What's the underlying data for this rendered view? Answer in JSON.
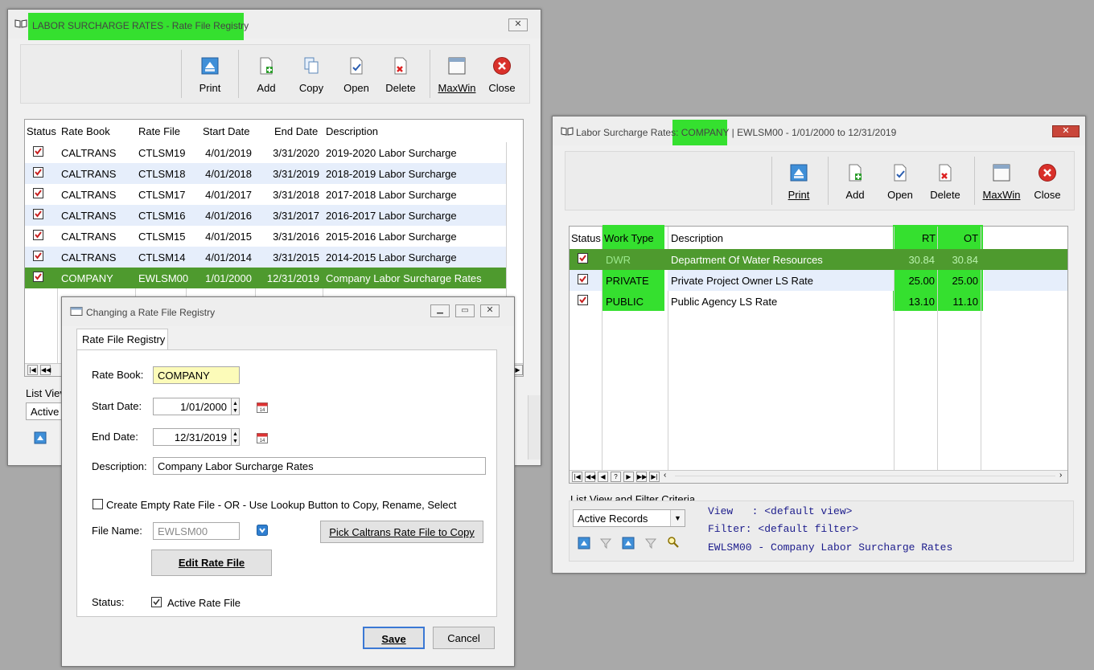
{
  "win1": {
    "title": "LABOR SURCHARGE RATES - Rate File Registry",
    "toolbar": {
      "print": "Print",
      "add": "Add",
      "copy": "Copy",
      "open": "Open",
      "delete": "Delete",
      "maxwin": "MaxWin",
      "close": "Close"
    },
    "columns": [
      "Status",
      "Rate Book",
      "Rate File",
      "Start Date",
      "End Date",
      "Description"
    ],
    "rows": [
      {
        "book": "CALTRANS",
        "file": "CTLSM19",
        "start": "4/01/2019",
        "end": "3/31/2020",
        "desc": "2019-2020 Labor Surcharge"
      },
      {
        "book": "CALTRANS",
        "file": "CTLSM18",
        "start": "4/01/2018",
        "end": "3/31/2019",
        "desc": "2018-2019 Labor Surcharge"
      },
      {
        "book": "CALTRANS",
        "file": "CTLSM17",
        "start": "4/01/2017",
        "end": "3/31/2018",
        "desc": "2017-2018 Labor Surcharge"
      },
      {
        "book": "CALTRANS",
        "file": "CTLSM16",
        "start": "4/01/2016",
        "end": "3/31/2017",
        "desc": "2016-2017 Labor Surcharge"
      },
      {
        "book": "CALTRANS",
        "file": "CTLSM15",
        "start": "4/01/2015",
        "end": "3/31/2016",
        "desc": "2015-2016 Labor Surcharge"
      },
      {
        "book": "CALTRANS",
        "file": "CTLSM14",
        "start": "4/01/2014",
        "end": "3/31/2015",
        "desc": "2014-2015 Labor Surcharge"
      },
      {
        "book": "COMPANY",
        "file": "EWLSM00",
        "start": "1/01/2000",
        "end": "12/31/2019",
        "desc": "Company Labor Surcharge Rates"
      }
    ],
    "list_view_label": "List Viev",
    "list_view_value": "Active"
  },
  "win2": {
    "title_prefix": "Labor Surcharge Rates: ",
    "title_company": "COMPANY",
    "title_suffix": " | EWLSM00 -  1/01/2000 to 12/31/2019",
    "toolbar": {
      "print": "Print",
      "add": "Add",
      "open": "Open",
      "delete": "Delete",
      "maxwin": "MaxWin",
      "close": "Close"
    },
    "columns": [
      "Status",
      "Work Type",
      "Description",
      "RT",
      "OT"
    ],
    "rows": [
      {
        "type": "DWR",
        "desc": "Department Of Water Resources",
        "rt": "30.84",
        "ot": "30.84"
      },
      {
        "type": "PRIVATE",
        "desc": "Private Project Owner LS Rate",
        "rt": "25.00",
        "ot": "25.00"
      },
      {
        "type": "PUBLIC",
        "desc": "Public Agency LS Rate",
        "rt": "13.10",
        "ot": "11.10"
      }
    ],
    "filter_label": "List View and Filter Criteria",
    "filter_select": "Active Records",
    "view_line": "View   : <default view>",
    "filter_line": "Filter: <default filter>",
    "file_line": "EWLSM00 - Company Labor Surcharge Rates"
  },
  "dialog": {
    "title": "Changing a Rate File Registry",
    "tab": "Rate File Registry",
    "rate_book_label": "Rate Book:",
    "rate_book_value": "COMPANY",
    "start_label": "Start Date:",
    "start_value": "1/01/2000",
    "end_label": "End Date:",
    "end_value": "12/31/2019",
    "desc_label": "Description:",
    "desc_value": "Company Labor Surcharge Rates",
    "create_empty_label": "Create Empty Rate File - OR - Use Lookup Button to Copy, Rename, Select",
    "file_name_label": "File Name:",
    "file_name_value": "EWLSM00",
    "pick_button": "Pick Caltrans Rate File to Copy",
    "edit_button": "Edit Rate File",
    "status_label": "Status:",
    "active_label": "Active Rate File",
    "save": "Save",
    "cancel": "Cancel"
  },
  "colors": {
    "highlight": "#35e02f",
    "selected_row": "#4e9a2e",
    "alt_row": "#e6eefb"
  }
}
